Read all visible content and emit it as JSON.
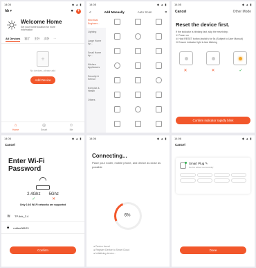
{
  "phone1": {
    "status_time": "14:05",
    "home_name": "hb",
    "welcome_title": "Welcome Home",
    "welcome_sub": "Set your home location for more information",
    "tabs": [
      "All Devices",
      "客厅",
      "主卧",
      "次卧",
      "···"
    ],
    "no_devices": "No devices, please add",
    "add_button": "Add Device",
    "nav": [
      "Home",
      "Smart",
      "Me"
    ]
  },
  "phone2": {
    "status_time": "14:05",
    "back": "<",
    "tab_manual": "Add Manually",
    "tab_auto": "Auto Scan",
    "categories": [
      "Electrical Engineer...",
      "Lighting",
      "Large Home Ap...",
      "Small Home Ap...",
      "Kitchen Appliances",
      "Security & Sensor",
      "Exercise & Health",
      "Others"
    ],
    "tile_count": 24
  },
  "phone3": {
    "status_time": "14:05",
    "cancel": "Cancel",
    "other": "Other Mode",
    "title": "Reset the device first.",
    "desc_lines": [
      "If the indicator is blinking fast, skip the reset step.",
      "① Power on",
      "② Hold RESET button (switch) for 5s (Subject to User Manual)",
      "③ Ensure indicator light is fast blinking"
    ],
    "confirm": "Confirm indicator rapidly blink"
  },
  "phone4": {
    "status_time": "14:06",
    "cancel": "Cancel",
    "title": "Enter Wi-Fi Password",
    "band_24": "2.4Ghz",
    "band_5": "5Ghz",
    "note": "Only 2.4G Wi-Fi networks are supported",
    "wifi_name": "TP-link_2.4",
    "password": "ruiduo08123",
    "confirm": "Confirm"
  },
  "phone5": {
    "status_time": "14:06",
    "title": "Connecting...",
    "desc": "Place your router, mobile phone, and device as close as possible",
    "progress_pct": "6%",
    "progress": 0.06,
    "steps": [
      "● Device found",
      "● Register Device to Smart Cloud",
      "● Initializing device..."
    ]
  },
  "phone6": {
    "status_time": "14:06",
    "cancel": "Cancel",
    "device_name": "Smart Plug",
    "device_status": "Device added successfully",
    "done": "Done"
  }
}
